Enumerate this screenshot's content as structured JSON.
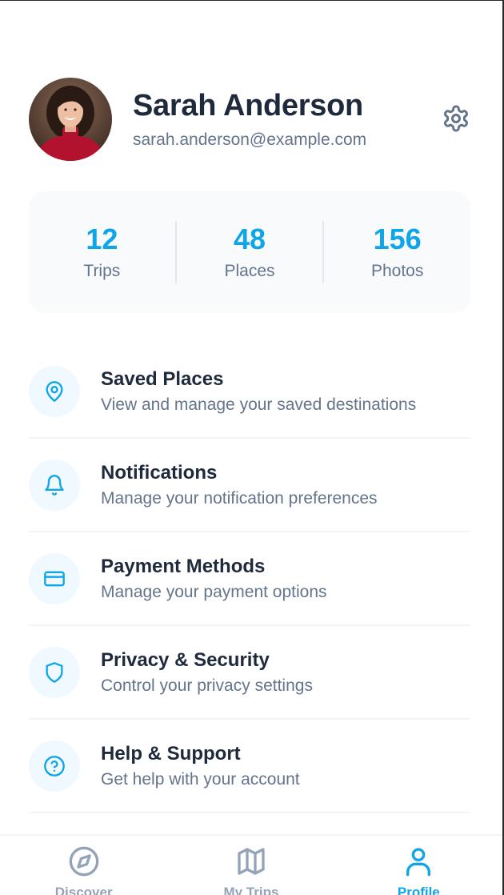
{
  "profile": {
    "name": "Sarah Anderson",
    "email": "sarah.anderson@example.com"
  },
  "stats": [
    {
      "value": "12",
      "label": "Trips"
    },
    {
      "value": "48",
      "label": "Places"
    },
    {
      "value": "156",
      "label": "Photos"
    }
  ],
  "menu": [
    {
      "icon": "map-pin-icon",
      "title": "Saved Places",
      "subtitle": "View and manage your saved destinations"
    },
    {
      "icon": "bell-icon",
      "title": "Notifications",
      "subtitle": "Manage your notification preferences"
    },
    {
      "icon": "credit-card-icon",
      "title": "Payment Methods",
      "subtitle": "Manage your payment options"
    },
    {
      "icon": "shield-icon",
      "title": "Privacy & Security",
      "subtitle": "Control your privacy settings"
    },
    {
      "icon": "help-circle-icon",
      "title": "Help & Support",
      "subtitle": "Get help with your account"
    }
  ],
  "tabs": [
    {
      "icon": "compass-icon",
      "label": "Discover",
      "active": false
    },
    {
      "icon": "map-icon",
      "label": "My Trips",
      "active": false
    },
    {
      "icon": "user-icon",
      "label": "Profile",
      "active": true
    }
  ],
  "colors": {
    "accent": "#0ea5e9",
    "text_primary": "#1e293b",
    "text_secondary": "#64748b",
    "tab_inactive": "#94a3b8",
    "icon_bg": "#f0f9ff",
    "stats_bg": "#f8fafc"
  }
}
